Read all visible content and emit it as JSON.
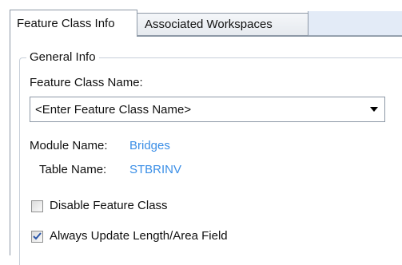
{
  "tabs": [
    {
      "label": "Feature Class Info",
      "active": true
    },
    {
      "label": "Associated Workspaces",
      "active": false
    }
  ],
  "general_info": {
    "legend": "General Info",
    "feature_class_name_label": "Feature Class Name:",
    "feature_class_name_value": "<Enter Feature Class Name>",
    "module_name_label": "Module Name:",
    "module_name_value": "Bridges",
    "table_name_label": "Table Name:",
    "table_name_value": "STBRINV"
  },
  "options": {
    "disable_feature_class": {
      "label": "Disable Feature Class",
      "checked": false
    },
    "always_update_length": {
      "label": "Always Update Length/Area Field",
      "checked": true
    }
  },
  "colors": {
    "link_value": "#3a8ee6",
    "tab_strip_fill": "#e3ebf7",
    "border": "#8d98a6",
    "check_mark": "#2c57a8"
  },
  "icons": {
    "combo_arrow": "chevron-down-icon",
    "check": "check-icon"
  }
}
